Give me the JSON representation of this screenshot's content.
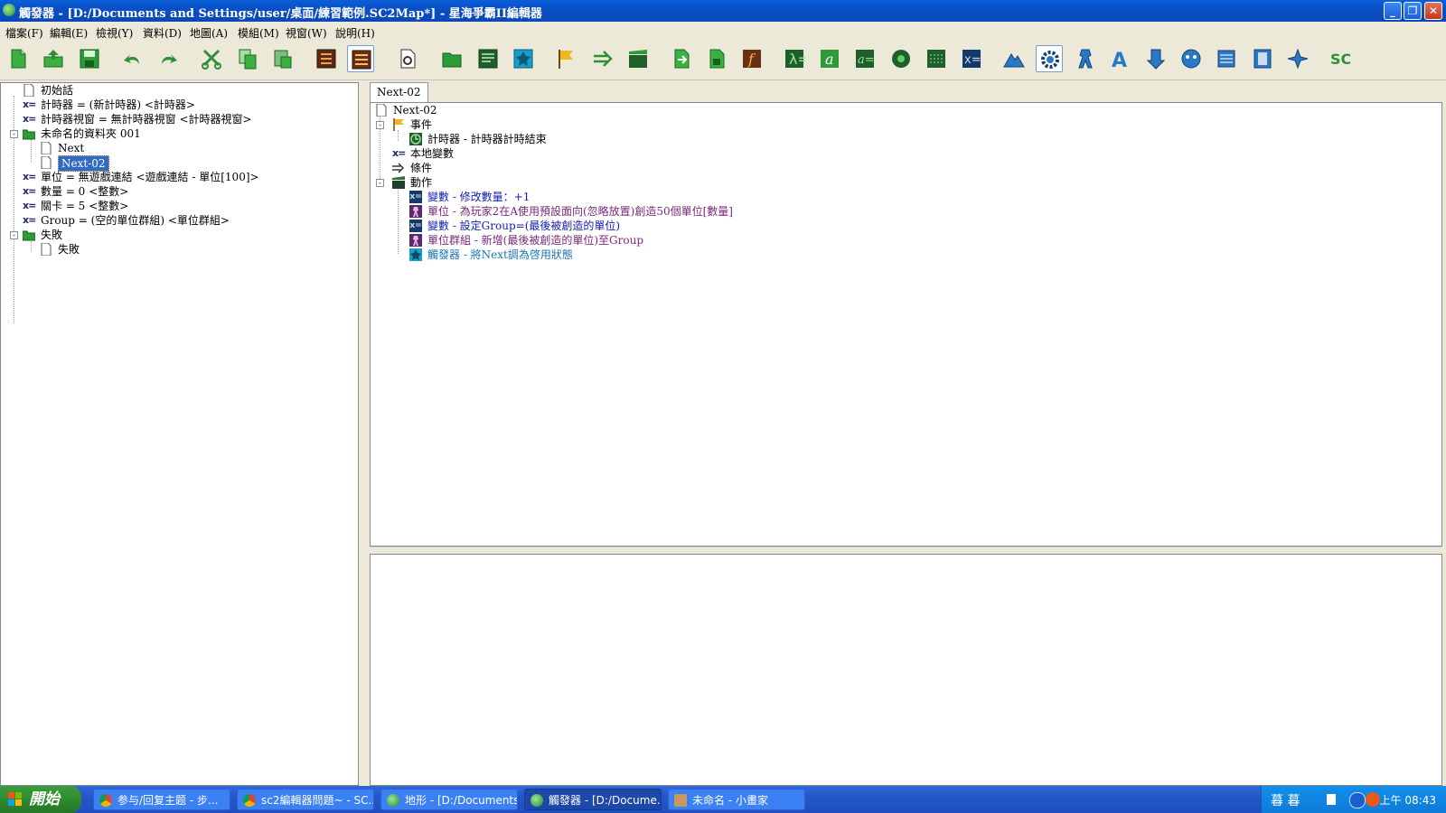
{
  "window": {
    "title": "觸發器 - [D:/Documents and Settings/user/桌面/練習範例.SC2Map*] - 星海爭霸II編輯器",
    "minimize": "_",
    "restore": "❐",
    "close": "✕"
  },
  "menu": [
    "檔案(F)",
    "編輯(E)",
    "檢視(Y)",
    "資料(D)",
    "地圖(A)",
    "模組(M)",
    "視窗(W)",
    "說明(H)"
  ],
  "toolbar": {
    "icons": [
      "new-icon",
      "open-icon",
      "save-icon",
      "undo-icon",
      "redo-icon",
      "cut-icon",
      "copy-icon",
      "paste-icon",
      "trigger-list-icon",
      "trigger-editor-icon",
      "new-trigger-icon",
      "folder-icon",
      "script-icon",
      "preset-icon",
      "event-flag-icon",
      "condition-arrow-icon",
      "cinematic-icon",
      "action-arrow-icon",
      "action-file-icon",
      "function-icon",
      "lambda-icon",
      "variable-a-icon",
      "variable-assign-icon",
      "record-icon",
      "binary-icon",
      "x-equals-icon",
      "terrain-icon",
      "trigger-gear-icon",
      "unit-icon",
      "text-icon",
      "import-icon",
      "ai-icon",
      "data-icon",
      "movie-icon",
      "flyer-icon",
      "sc-icon"
    ]
  },
  "left_tree": {
    "items": [
      {
        "text": "初始話",
        "icon": "doc"
      },
      {
        "text": "計時器 = (新計時器) <計時器>",
        "icon": "var"
      },
      {
        "text": "計時器視窗 = 無計時器視窗 <計時器視窗>",
        "icon": "var"
      },
      {
        "text": "未命名的資料夾 001",
        "icon": "folder"
      },
      {
        "text": "Next",
        "icon": "doc"
      },
      {
        "text": "Next-02",
        "icon": "doc"
      },
      {
        "text": "單位 = 無遊戲連結 <遊戲連結 - 單位[100]>",
        "icon": "var"
      },
      {
        "text": "數量 = 0 <整數>",
        "icon": "var"
      },
      {
        "text": "關卡 = 5 <整數>",
        "icon": "var"
      },
      {
        "text": "Group = (空的單位群組) <單位群組>",
        "icon": "var"
      },
      {
        "text": "失敗",
        "icon": "folder"
      },
      {
        "text": "失敗",
        "icon": "doc"
      }
    ],
    "expand_minus": "-"
  },
  "tab": {
    "label": "Next-02"
  },
  "right_tree": {
    "root": "Next-02",
    "events_label": "事件",
    "event_item": "計時器 - 計時器計時結束",
    "locals_label": "本地變數",
    "conditions_label": "條件",
    "actions_label": "動作",
    "actions": [
      {
        "text": "變數 - 修改數量：+1",
        "color": "#1420b0"
      },
      {
        "text": "單位 - 為玩家2在A使用預設面向(忽略放置)創造50個單位[數量]",
        "color": "#7a2878"
      },
      {
        "text": "變數 - 設定Group=(最後被創造的單位)",
        "color": "#1420b0"
      },
      {
        "text": "單位群組 - 新增(最後被創造的單位)至Group",
        "color": "#7a2878"
      },
      {
        "text": "觸發器 - 將Next調為啓用狀態",
        "color": "#1a74b0"
      }
    ]
  },
  "taskbar": {
    "start": "開始",
    "tasks": [
      {
        "label": "参与/回复主题 - 步...",
        "icon": "chrome-icon"
      },
      {
        "label": "sc2編輯器問題~ - SC...",
        "icon": "chrome-icon"
      },
      {
        "label": "地形 - [D:/Documents ...",
        "icon": "sc2-editor-icon"
      },
      {
        "label": "觸發器 - [D:/Docume...",
        "icon": "sc2-editor-icon"
      },
      {
        "label": "未命名 - 小畫家",
        "icon": "paint-icon"
      }
    ],
    "tray_ime": "暮 暮",
    "clock": "上午 08:43"
  },
  "colors": {
    "selection": "#316ac5",
    "titlebar": "#0a4fc6"
  }
}
